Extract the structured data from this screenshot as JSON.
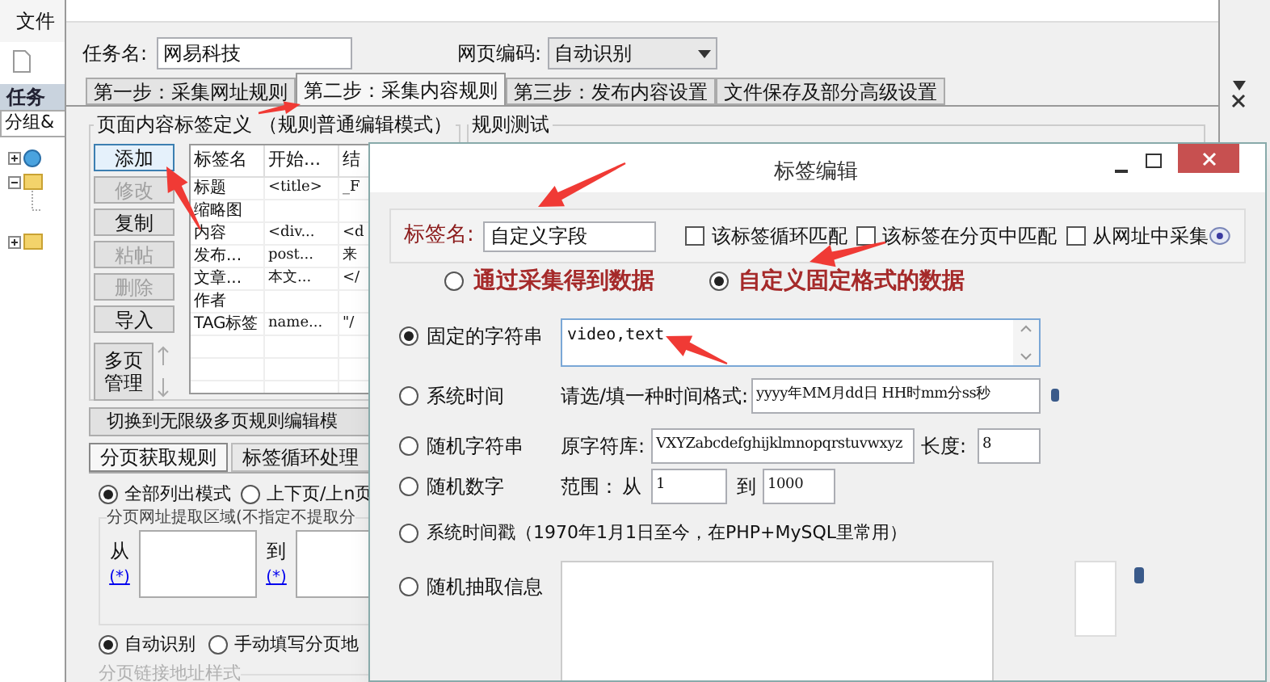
{
  "app": {
    "menu": [
      "文件"
    ],
    "sidebar_tab": "任务",
    "sidebar_group": "分组&"
  },
  "task_window": {
    "task_name_label": "任务名:",
    "task_name": "网易科技",
    "encoding_label": "网页编码:",
    "encoding": "自动识别",
    "tabs": [
      {
        "label": "第一步：采集网址规则",
        "selected": false
      },
      {
        "label": "第二步：采集内容规则",
        "selected": true
      },
      {
        "label": "第三步：发布内容设置",
        "selected": false
      },
      {
        "label": "文件保存及部分高级设置",
        "selected": false
      }
    ],
    "tag_group": {
      "title": "页面内容标签定义 （规则普通编辑模式）",
      "buttons": [
        {
          "label": "添加",
          "disabled": false,
          "focused": true
        },
        {
          "label": "修改",
          "disabled": true,
          "focused": false
        },
        {
          "label": "复制",
          "disabled": false,
          "focused": false
        },
        {
          "label": "粘帖",
          "disabled": true,
          "focused": false
        },
        {
          "label": "删除",
          "disabled": true,
          "focused": false
        },
        {
          "label": "导入",
          "disabled": false,
          "focused": false
        }
      ],
      "multi_page_button": "多页管理",
      "table": {
        "columns": [
          "标签名",
          "开始...",
          "结"
        ],
        "rows": [
          [
            "标题",
            "<title>",
            "_F"
          ],
          [
            "缩略图",
            "",
            ""
          ],
          [
            "内容",
            "<div...",
            "<d"
          ],
          [
            "发布...",
            "post...",
            "来"
          ],
          [
            "文章...",
            "本文...",
            "</"
          ],
          [
            "作者",
            "",
            ""
          ],
          [
            "TAG标签",
            "name...",
            "\"/"
          ]
        ]
      }
    },
    "switch_button": "切换到无限级多页规则编辑模",
    "sub_tabs": [
      {
        "label": "分页获取规则",
        "selected": true
      },
      {
        "label": "标签循环处理",
        "selected": false
      }
    ],
    "list_modes": [
      {
        "label": "全部列出模式",
        "selected": true
      },
      {
        "label": "上下页/上n页",
        "selected": false
      }
    ],
    "region_group": {
      "title": "分页网址提取区域(不指定不提取分",
      "from_label": "从",
      "from_link": "(*)",
      "to_label": "到",
      "to_link": "(*)"
    },
    "detect_modes": [
      {
        "label": "自动识别",
        "selected": true
      },
      {
        "label": "手动填写分页地",
        "selected": false
      }
    ],
    "link_style_title": "分页链接地址样式",
    "test_group_title": "规则测试"
  },
  "dialog": {
    "title": "标签编辑",
    "tag_name_label": "标签名:",
    "tag_name": "自定义字段",
    "checks": [
      {
        "label": "该标签循环匹配",
        "checked": false
      },
      {
        "label": "该标签在分页中匹配",
        "checked": false
      },
      {
        "label": "从网址中采集",
        "checked": false
      }
    ],
    "sources": [
      {
        "label": "通过采集得到数据",
        "selected": false
      },
      {
        "label": "自定义固定格式的数据",
        "selected": true
      }
    ],
    "options": [
      {
        "kind": "text",
        "label": "固定的字符串",
        "selected": true,
        "value": "video,text"
      },
      {
        "kind": "time",
        "label": "系统时间",
        "selected": false,
        "prompt": "请选/填一种时间格式:",
        "value": "yyyy年MM月dd日 HH时mm分ss秒"
      },
      {
        "kind": "charset",
        "label": "随机字符串",
        "selected": false,
        "charset_label": "原字符库:",
        "charset": "VXYZabcdefghijklmnopqrstuvwxyz",
        "length_label": "长度:",
        "length": "8"
      },
      {
        "kind": "range",
        "label": "随机数字",
        "selected": false,
        "range_label": "范围：",
        "from_label": "从",
        "from": "1",
        "to_label": "到",
        "to": "1000"
      },
      {
        "kind": "plain",
        "label": "系统时间戳（1970年1月1日至今，在PHP+MySQL里常用）",
        "selected": false
      },
      {
        "kind": "list",
        "label": "随机抽取信息",
        "selected": false
      }
    ]
  }
}
